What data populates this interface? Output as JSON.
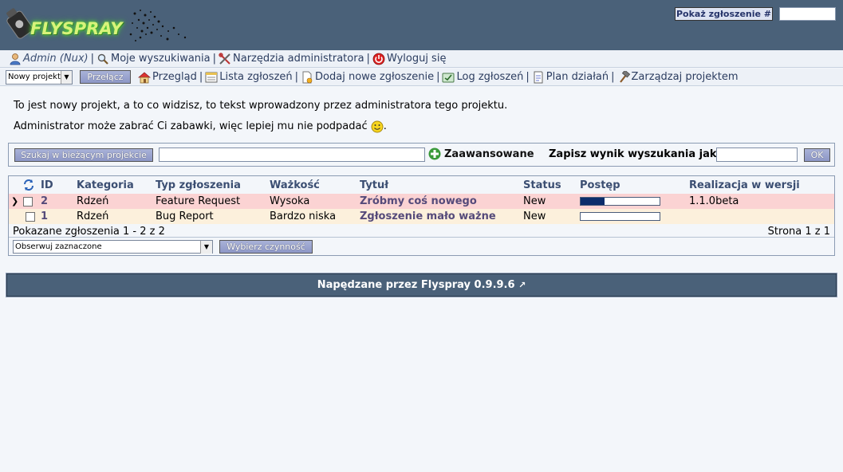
{
  "header": {
    "logo_text": "FLYSPRAY",
    "show_task_label": "Pokaż zgłoszenie #",
    "show_task_value": ""
  },
  "user_menu": {
    "admin": "Admin (Nux)",
    "my_searches": "Moje wyszukiwania",
    "admin_tools": "Narzędzia administratora",
    "logout": "Wyloguj się"
  },
  "project_menu": {
    "project_selected": "Nowy projekt",
    "switch_label": "Przełącz",
    "overview": "Przegląd",
    "task_list": "Lista zgłoszeń",
    "add_task": "Dodaj nowe zgłoszenie",
    "events": "Log zgłoszeń",
    "roadmap": "Plan działań",
    "manage": "Zarządzaj projektem"
  },
  "intro": {
    "line1": "To jest nowy projekt, a to co widzisz, to tekst wprowadzony przez administratora tego projektu.",
    "line2": "Administrator może zabrać Ci zabawki, więc lepiej mu nie podpadać"
  },
  "search": {
    "button_label": "Szukaj w bieżącym projekcie",
    "input_value": "",
    "advanced_label": "Zaawansowane",
    "save_label": "Zapisz wynik wyszukania jako",
    "save_value": "",
    "ok_label": "OK"
  },
  "task_table": {
    "columns": {
      "id": "ID",
      "category": "Kategoria",
      "type": "Typ zgłoszenia",
      "severity": "Ważkość",
      "summary": "Tytuł",
      "status": "Status",
      "progress": "Postęp",
      "due_version": "Realizacja w wersji"
    },
    "rows": [
      {
        "id": "2",
        "category": "Rdzeń",
        "type": "Feature Request",
        "severity": "Wysoka",
        "summary": "Zróbmy coś nowego",
        "status": "New",
        "progress": 0.3,
        "due_version": "1.1.0beta",
        "current": true
      },
      {
        "id": "1",
        "category": "Rdzeń",
        "type": "Bug Report",
        "severity": "Bardzo niska",
        "summary": "Zgłoszenie mało ważne",
        "status": "New",
        "progress": 0,
        "due_version": "",
        "current": false
      }
    ],
    "shown_text": "Pokazane zgłoszenia 1 - 2 z 2",
    "page_text": "Strona 1 z 1",
    "action_select": "Obserwuj zaznaczone",
    "action_button": "Wybierz czynność"
  },
  "footer": {
    "text": "Napędzane przez Flyspray 0.9.9.6",
    "arrow": "↗"
  }
}
